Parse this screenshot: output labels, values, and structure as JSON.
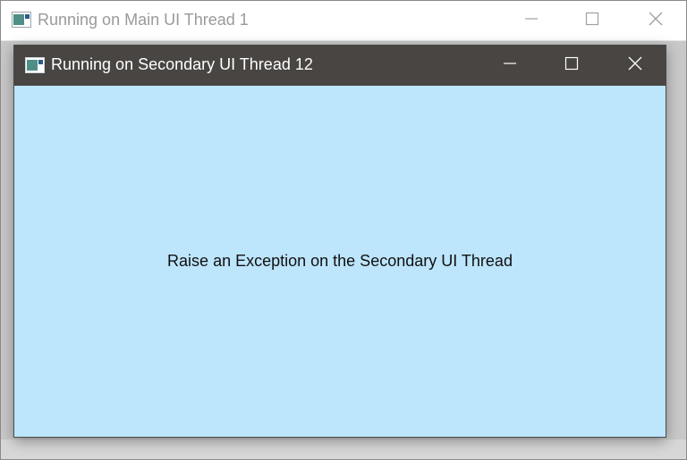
{
  "main_window": {
    "title": "Running on Main UI Thread 1",
    "icons": {
      "app": "app-window-icon",
      "minimize": "minimize-icon",
      "maximize": "maximize-icon",
      "close": "close-icon"
    },
    "colors": {
      "titlebar": "#ffffff",
      "title_text": "#9a9a9a"
    }
  },
  "secondary_window": {
    "title": "Running on Secondary UI Thread 12",
    "icons": {
      "app": "app-window-icon",
      "minimize": "minimize-icon",
      "maximize": "maximize-icon",
      "close": "close-icon"
    },
    "button_label": "Raise an Exception on the Secondary UI Thread",
    "colors": {
      "titlebar": "#484542",
      "title_text": "#ffffff",
      "client_background": "#bde5fb"
    }
  }
}
